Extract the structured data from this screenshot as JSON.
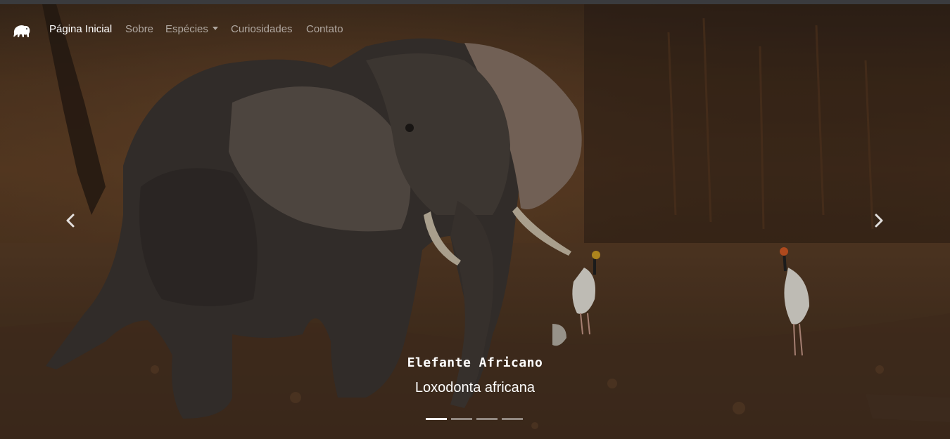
{
  "navbar": {
    "brand_icon": "elephant-icon",
    "items": [
      {
        "label": "Página Inicial",
        "active": true
      },
      {
        "label": "Sobre",
        "active": false
      },
      {
        "label": "Espécies",
        "active": false,
        "dropdown": true
      },
      {
        "label": "Curiosidades",
        "active": false
      },
      {
        "label": "Contato",
        "active": false
      }
    ]
  },
  "carousel": {
    "prev_icon": "chevron-left-icon",
    "next_icon": "chevron-right-icon",
    "caption": {
      "title": "Elefante Africano",
      "subtitle": "Loxodonta africana"
    },
    "slide_count": 4,
    "active_slide": 1
  },
  "colors": {
    "nav_active": "#ffffff",
    "nav_inactive": "rgba(255,255,255,0.58)",
    "scene_mud": "#5a3c24"
  }
}
